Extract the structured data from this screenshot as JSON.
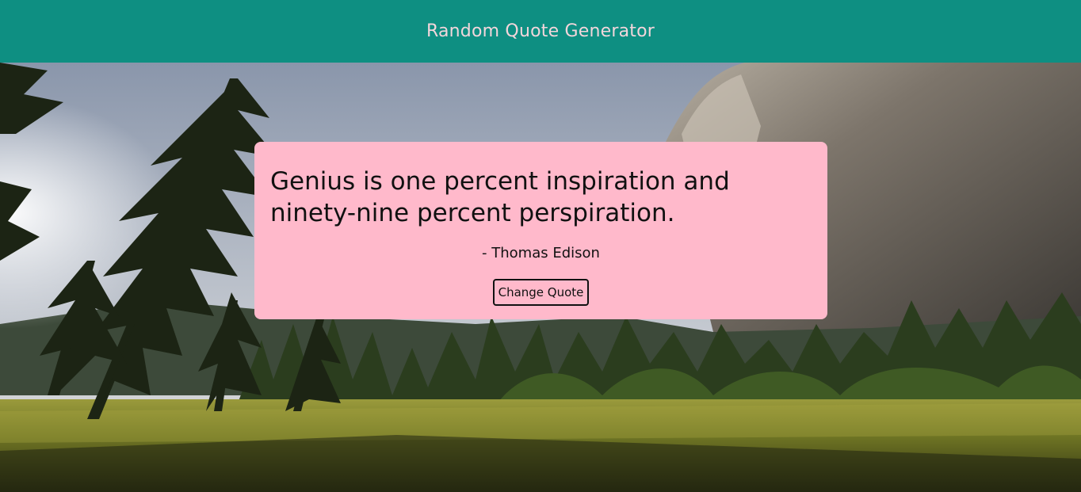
{
  "header": {
    "title": "Random Quote Generator"
  },
  "quote": {
    "text": "Genius is one percent inspiration and ninety-nine percent perspiration.",
    "author": "- Thomas Edison",
    "button_label": "Change Quote"
  },
  "colors": {
    "header_bg": "#0e8f82",
    "header_text": "#f3d6db",
    "card_bg": "#ffb9cb"
  },
  "background": {
    "scene": "mountain-valley-landscape"
  }
}
